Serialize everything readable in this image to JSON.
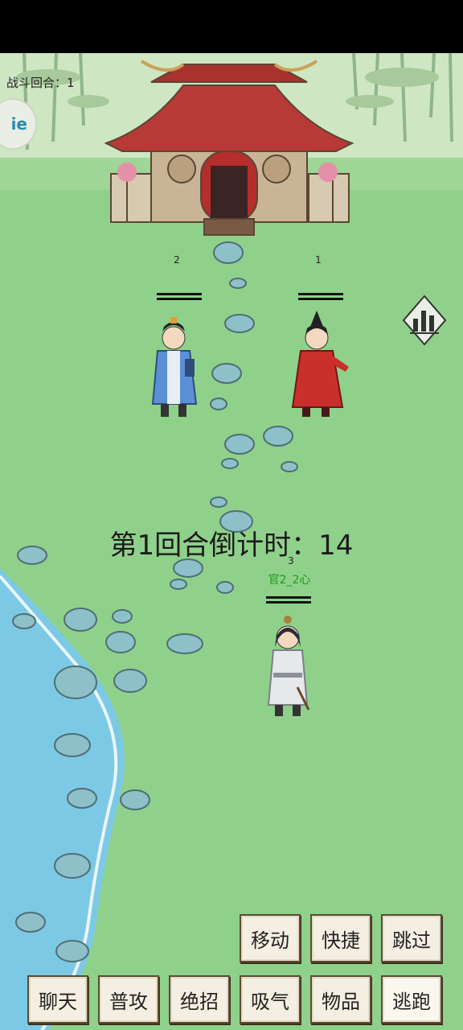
{
  "hud": {
    "round_label": "战斗回合：1",
    "badge_text": "ie"
  },
  "units": [
    {
      "id": "enemy-2",
      "number": "2"
    },
    {
      "id": "enemy-1",
      "number": "1"
    }
  ],
  "player": {
    "number": "3",
    "name": "官2_2心"
  },
  "countdown": "第1回合倒计时：14",
  "actions_top": [
    "移动",
    "快捷",
    "跳过"
  ],
  "actions_bottom": [
    "聊天",
    "普攻",
    "绝招",
    "吸气",
    "物品",
    "逃跑"
  ],
  "colors": {
    "grass": "#8fd18a",
    "water": "#7cc9e6",
    "roof": "#b83a36",
    "button_bg": "#f4efe2"
  },
  "icons": [
    "stats-chart-icon"
  ]
}
